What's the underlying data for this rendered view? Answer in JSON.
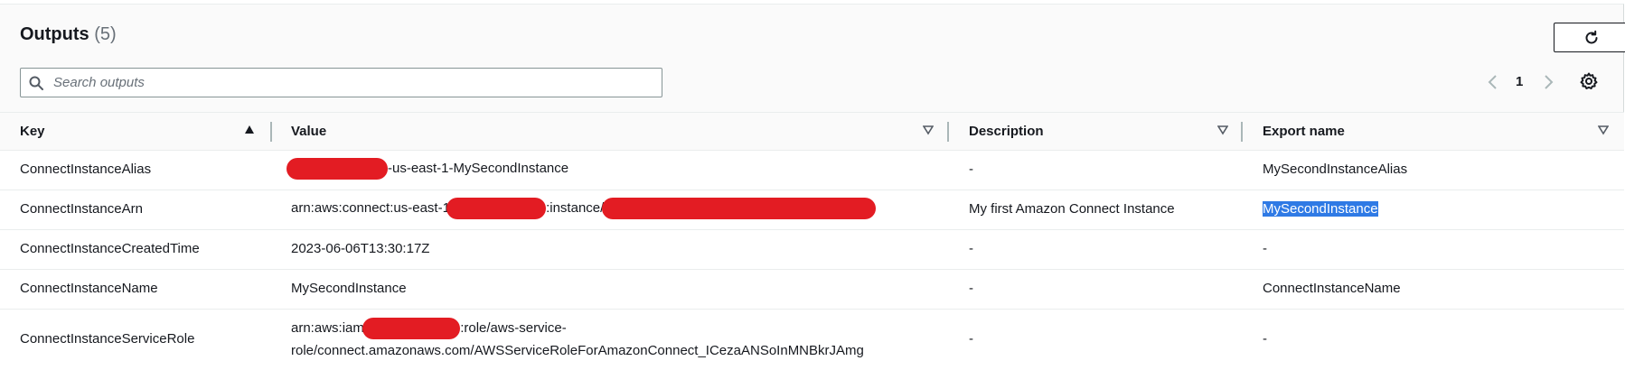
{
  "header": {
    "title": "Outputs",
    "count": "(5)"
  },
  "search": {
    "placeholder": "Search outputs",
    "value": ""
  },
  "pagination": {
    "current_page": "1"
  },
  "table": {
    "columns": [
      "Key",
      "Value",
      "Description",
      "Export name"
    ],
    "rows": [
      {
        "key": "ConnectInstanceAlias",
        "value_parts": [
          "-us-east-1-MySecondInstance"
        ],
        "description": "-",
        "export_name": "MySecondInstanceAlias"
      },
      {
        "key": "ConnectInstanceArn",
        "value_parts": [
          "arn:aws:connect:us-east-1:",
          ":instance/"
        ],
        "description": "My first Amazon Connect Instance",
        "export_name": "MySecondInstance"
      },
      {
        "key": "ConnectInstanceCreatedTime",
        "value_parts": [
          "2023-06-06T13:30:17Z"
        ],
        "description": "-",
        "export_name": "-"
      },
      {
        "key": "ConnectInstanceName",
        "value_parts": [
          "MySecondInstance"
        ],
        "description": "-",
        "export_name": "ConnectInstanceName"
      },
      {
        "key": "ConnectInstanceServiceRole",
        "value_parts": [
          "arn:aws:iam::",
          ":role/aws-service-",
          "role/connect.amazonaws.com/AWSServiceRoleForAmazonConnect_ICezaANSoInMNBkrJAmg"
        ],
        "description": "-",
        "export_name": "-"
      }
    ]
  },
  "colors": {
    "redaction": "#e31c23",
    "selection_highlight": "#2f7ae5"
  },
  "icons": [
    "refresh-icon",
    "search-icon",
    "chevron-left-icon",
    "chevron-right-icon",
    "gear-icon",
    "sort-ascending-icon",
    "sort-descending-icon"
  ]
}
